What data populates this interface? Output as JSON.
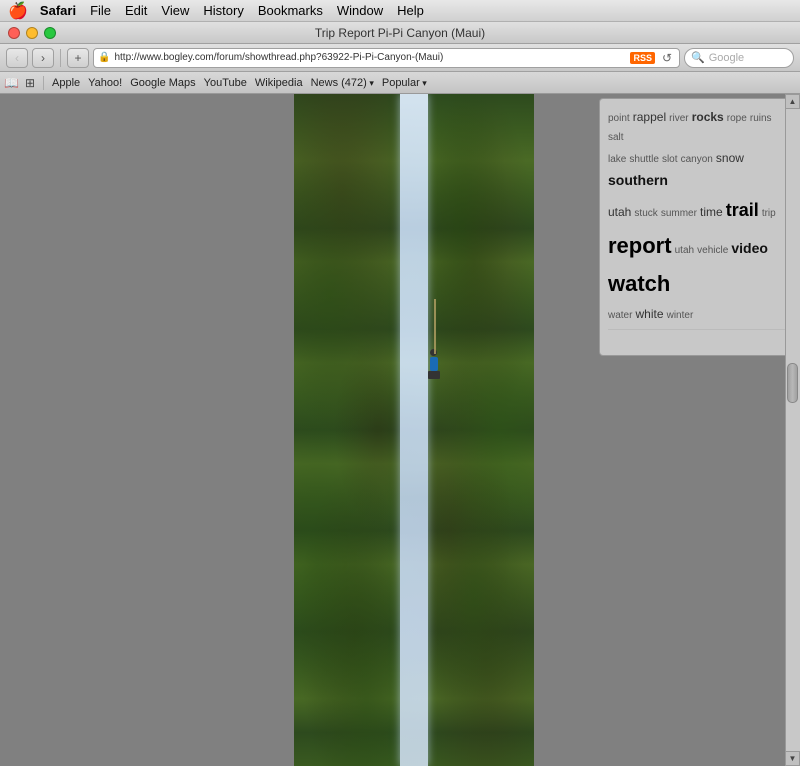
{
  "menubar": {
    "apple": "🍎",
    "items": [
      "Safari",
      "File",
      "Edit",
      "View",
      "History",
      "Bookmarks",
      "Window",
      "Help"
    ]
  },
  "titlebar": {
    "title": "Trip Report Pi-Pi Canyon (Maui)"
  },
  "toolbar": {
    "back_label": "‹",
    "forward_label": "›",
    "address": "http://www.bogley.com/forum/showthread.php?63922-Pi-Pi-Canyon-(Maui)",
    "rss": "RSS",
    "search_placeholder": "Google"
  },
  "bookmarks": {
    "icons": [
      "📖",
      "☰"
    ],
    "items": [
      "Apple",
      "Yahoo!",
      "Google Maps",
      "YouTube",
      "Wikipedia",
      "News (472)▾",
      "Popular▾"
    ]
  },
  "tag_cloud": {
    "tags": [
      {
        "text": "point",
        "size": "small"
      },
      {
        "text": "rappel",
        "size": "medium"
      },
      {
        "text": "river",
        "size": "small"
      },
      {
        "text": "rocks",
        "size": "medium"
      },
      {
        "text": "rope",
        "size": "small"
      },
      {
        "text": "ruins",
        "size": "small"
      },
      {
        "text": "salt",
        "size": "small"
      },
      {
        "text": "lake",
        "size": "small"
      },
      {
        "text": "shuttle",
        "size": "small"
      },
      {
        "text": "slot",
        "size": "small"
      },
      {
        "text": "canyon",
        "size": "small"
      },
      {
        "text": "snow",
        "size": "medium"
      },
      {
        "text": "southern",
        "size": "large"
      },
      {
        "text": "utah",
        "size": "medium"
      },
      {
        "text": "stuck",
        "size": "small"
      },
      {
        "text": "summer",
        "size": "small"
      },
      {
        "text": "time",
        "size": "medium"
      },
      {
        "text": "trail",
        "size": "xlarge"
      },
      {
        "text": "trip",
        "size": "small"
      },
      {
        "text": "report",
        "size": "xxlarge"
      },
      {
        "text": "utah",
        "size": "small"
      },
      {
        "text": "vehicle",
        "size": "small"
      },
      {
        "text": "video",
        "size": "large"
      },
      {
        "text": "watch",
        "size": "xxlarge"
      },
      {
        "text": "water",
        "size": "small"
      },
      {
        "text": "white",
        "size": "medium"
      },
      {
        "text": "winter",
        "size": "small"
      }
    ]
  }
}
